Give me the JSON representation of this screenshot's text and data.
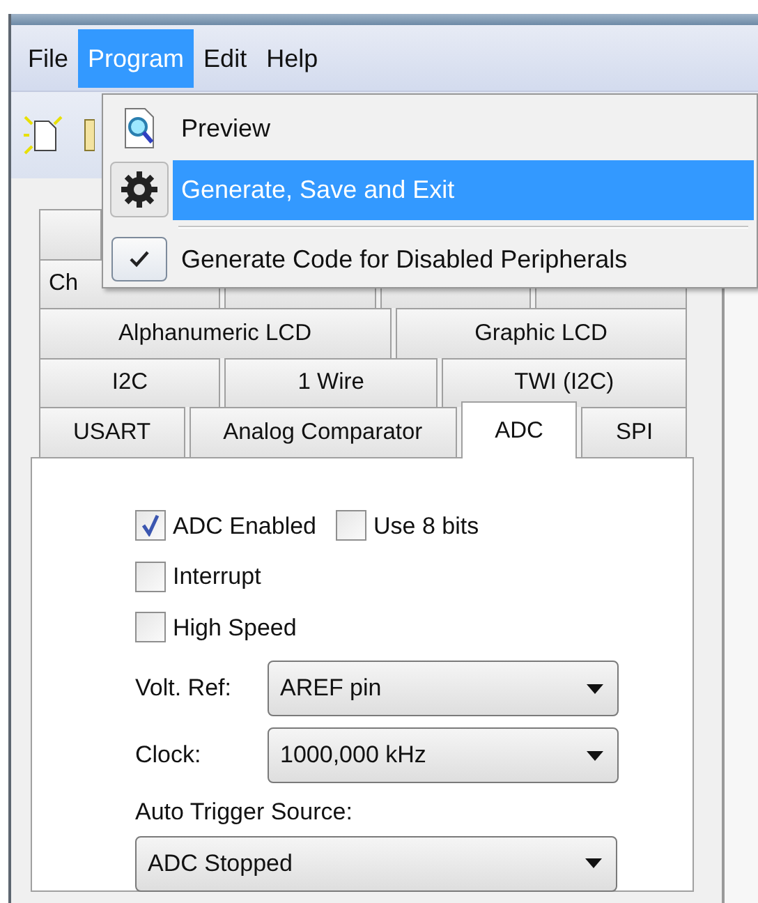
{
  "menu_bar": [
    {
      "label": "File",
      "selected": false
    },
    {
      "label": "Program",
      "selected": true
    },
    {
      "label": "Edit",
      "selected": false
    },
    {
      "label": "Help",
      "selected": false
    }
  ],
  "program_menu": [
    {
      "kind": "command",
      "label": "Preview",
      "selected": false
    },
    {
      "kind": "command",
      "label": "Generate, Save and Exit",
      "selected": true
    },
    {
      "kind": "separator"
    },
    {
      "kind": "toggle",
      "label": "Generate Code for Disabled Peripherals",
      "checked": true
    }
  ],
  "tab_rows": [
    [
      {
        "selected": false
      }
    ],
    [
      {
        "label": "Ch",
        "selected": false
      },
      {
        "selected": false
      },
      {
        "selected": false
      },
      {
        "selected": false
      }
    ],
    [
      {
        "label": "Alphanumeric LCD",
        "selected": false
      },
      {
        "label": "Graphic LCD",
        "selected": false
      }
    ],
    [
      {
        "label": "I2C",
        "selected": false
      },
      {
        "label": "1 Wire",
        "selected": false
      },
      {
        "label": "TWI (I2C)",
        "selected": false
      }
    ],
    [
      {
        "label": "USART",
        "selected": false
      },
      {
        "label": "Analog Comparator",
        "selected": false
      },
      {
        "label": "ADC",
        "selected": true
      },
      {
        "label": "SPI",
        "selected": false
      }
    ]
  ],
  "option_rows": [
    [
      {
        "label": "ADC Enabled",
        "checked": true
      },
      {
        "label": "Use 8 bits",
        "checked": false
      }
    ],
    [
      {
        "label": "Interrupt",
        "checked": false
      }
    ],
    [
      {
        "label": "High Speed",
        "checked": false
      }
    ]
  ],
  "volt_ref": {
    "label": "Volt. Ref:",
    "value": "AREF pin"
  },
  "clock": {
    "label": "Clock:",
    "value": "1000,000 kHz"
  },
  "auto_trigger": {
    "label": "Auto Trigger Source:",
    "value": "ADC Stopped"
  }
}
